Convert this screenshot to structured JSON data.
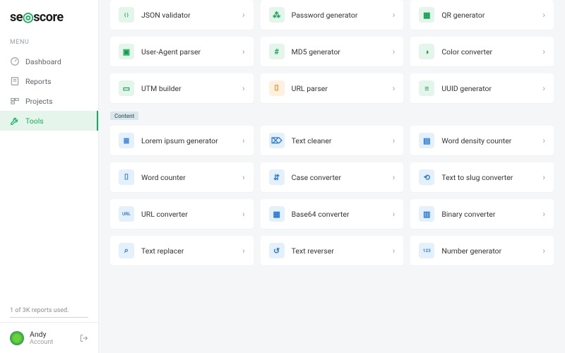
{
  "brand": {
    "prefix": "se",
    "o_glyph": "◎",
    "suffix": "score"
  },
  "menu_label": "MENU",
  "nav": [
    {
      "id": "dashboard",
      "label": "Dashboard",
      "active": false
    },
    {
      "id": "reports",
      "label": "Reports",
      "active": false
    },
    {
      "id": "projects",
      "label": "Projects",
      "active": false
    },
    {
      "id": "tools",
      "label": "Tools",
      "active": true
    }
  ],
  "usage_text": "1 of 3K reports used.",
  "account": {
    "name": "Andy",
    "subtitle": "Account"
  },
  "sections": [
    {
      "badge": null,
      "tools": [
        {
          "id": "json-validator",
          "label": "JSON validator",
          "glyph": "{ }",
          "cls": "ic-green"
        },
        {
          "id": "password-generator",
          "label": "Password generator",
          "glyph": "⁂",
          "cls": "ic-green"
        },
        {
          "id": "qr-generator",
          "label": "QR generator",
          "glyph": "▦",
          "cls": "ic-green"
        },
        {
          "id": "user-agent-parser",
          "label": "User-Agent parser",
          "glyph": "▣",
          "cls": "ic-green"
        },
        {
          "id": "md5-generator",
          "label": "MD5 generator",
          "glyph": "#",
          "cls": "ic-green"
        },
        {
          "id": "color-converter",
          "label": "Color converter",
          "glyph": "◑",
          "cls": "ic-green"
        },
        {
          "id": "utm-builder",
          "label": "UTM builder",
          "glyph": "▭",
          "cls": "ic-green"
        },
        {
          "id": "url-parser",
          "label": "URL parser",
          "glyph": "⌷",
          "cls": "ic-orange"
        },
        {
          "id": "uuid-generator",
          "label": "UUID generator",
          "glyph": "≡",
          "cls": "ic-green"
        }
      ]
    },
    {
      "badge": "Content",
      "tools": [
        {
          "id": "lorem-ipsum-generator",
          "label": "Lorem ipsum generator",
          "glyph": "≣",
          "cls": "ic-blue"
        },
        {
          "id": "text-cleaner",
          "label": "Text cleaner",
          "glyph": "⌦",
          "cls": "ic-blue"
        },
        {
          "id": "word-density-counter",
          "label": "Word density counter",
          "glyph": "▤",
          "cls": "ic-blue"
        },
        {
          "id": "word-counter",
          "label": "Word counter",
          "glyph": "⌷",
          "cls": "ic-blue"
        },
        {
          "id": "case-converter",
          "label": "Case converter",
          "glyph": "⇵",
          "cls": "ic-blue"
        },
        {
          "id": "text-to-slug-converter",
          "label": "Text to slug converter",
          "glyph": "⟲",
          "cls": "ic-blue"
        },
        {
          "id": "url-converter",
          "label": "URL converter",
          "glyph": "URL",
          "cls": "ic-blue"
        },
        {
          "id": "base64-converter",
          "label": "Base64 converter",
          "glyph": "▦",
          "cls": "ic-blue"
        },
        {
          "id": "binary-converter",
          "label": "Binary converter",
          "glyph": "▥",
          "cls": "ic-blue"
        },
        {
          "id": "text-replacer",
          "label": "Text replacer",
          "glyph": "⌕",
          "cls": "ic-blue"
        },
        {
          "id": "text-reverser",
          "label": "Text reverser",
          "glyph": "↺",
          "cls": "ic-blue"
        },
        {
          "id": "number-generator",
          "label": "Number generator",
          "glyph": "123",
          "cls": "ic-blue"
        }
      ]
    }
  ]
}
